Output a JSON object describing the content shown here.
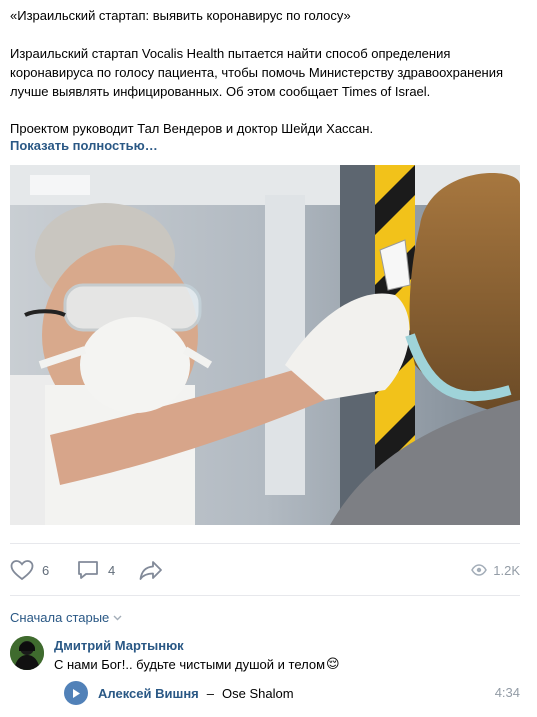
{
  "post": {
    "title_line": "«Израильский стартап: выявить коронавирус по голосу»",
    "body_lines": [
      "Израильский стартап Vocalis Health пытается найти способ определения",
      "коронавируса по голосу пациента, чтобы помочь Министерству здравоохранения",
      "лучше выявлять инфицированных. Об этом сообщает Times of Israel."
    ],
    "body_line_4": "Проектом руководит Тал Вендеров и доктор Шейди Хассан.",
    "show_more": "Показать полностью…"
  },
  "actions": {
    "likes": "6",
    "comments": "4",
    "views": "1.2K",
    "icons": [
      "heart-icon",
      "comment-icon",
      "share-icon",
      "eye-icon"
    ]
  },
  "comments_section": {
    "sort_label": "Сначала старые",
    "comment": {
      "author": "Дмитрий Мартынюк",
      "text": "С нами Бог!.. будьте чистыми душой и телом",
      "emoji": "😌",
      "audio": {
        "artist": "Алексей Вишня",
        "dash": "–",
        "title": "Ose Shalom",
        "duration": "4:34"
      }
    }
  },
  "colors": {
    "link": "#2a5885",
    "muted": "#939ca6",
    "play_button": "#5181b8"
  }
}
